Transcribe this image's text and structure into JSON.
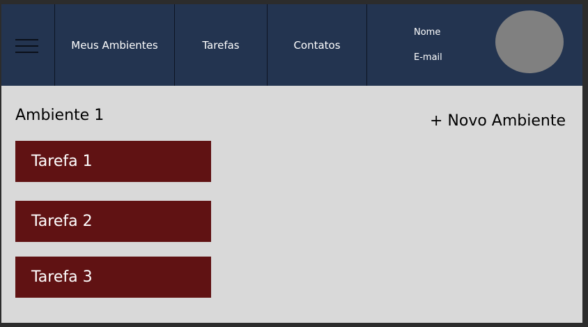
{
  "nav": {
    "menu_icon": "hamburger-menu-icon",
    "links": [
      "Meus Ambientes",
      "Tarefas",
      "Contatos"
    ],
    "user_name": "Nome",
    "user_email": "E-mail"
  },
  "main": {
    "title": "Ambiente 1",
    "new_button_label": "+ Novo Ambiente",
    "tasks": [
      "Tarefa 1",
      "Tarefa 2",
      "Tarefa 3"
    ]
  },
  "colors": {
    "navbar": "#233450",
    "content_bg": "#d9d9d9",
    "task_bg": "#601213",
    "avatar": "#808080"
  }
}
